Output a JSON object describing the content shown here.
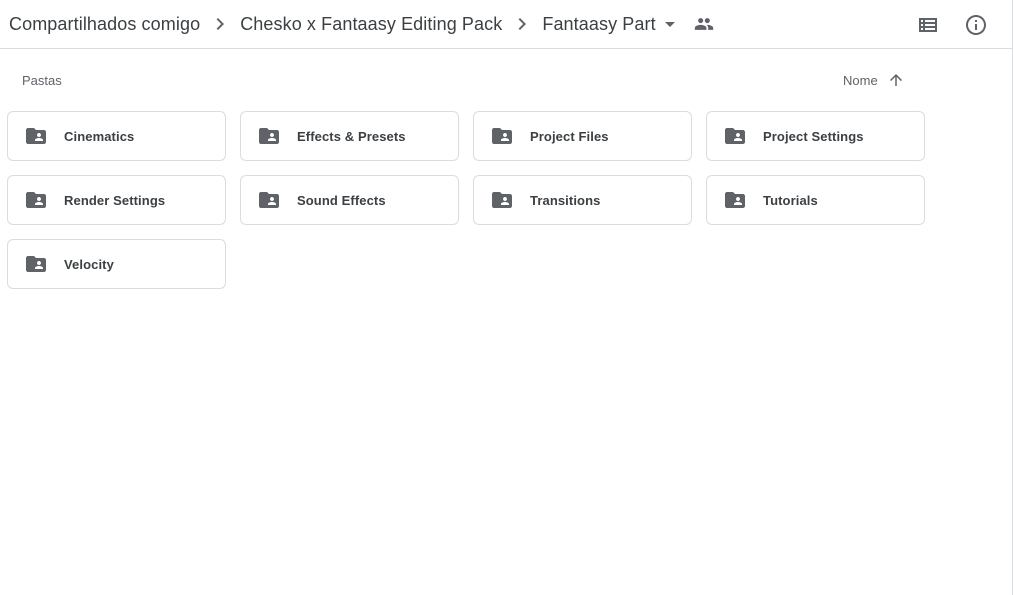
{
  "breadcrumb": {
    "items": [
      {
        "label": "Compartilhados comigo"
      },
      {
        "label": "Chesko x Fantaasy Editing Pack"
      },
      {
        "label": "Fantaasy Part"
      }
    ]
  },
  "header": {
    "icons": {
      "separator": "chevron-right-icon",
      "dropdown": "arrow-drop-down-icon",
      "shared": "people-icon",
      "list_view": "list-view-icon",
      "info": "info-icon"
    }
  },
  "section": {
    "label": "Pastas",
    "sort_label": "Nome",
    "sort_direction_icon": "arrow-up-icon"
  },
  "folders": [
    {
      "name": "Cinematics"
    },
    {
      "name": "Effects & Presets"
    },
    {
      "name": "Project Files"
    },
    {
      "name": "Project Settings"
    },
    {
      "name": "Render Settings"
    },
    {
      "name": "Sound Effects"
    },
    {
      "name": "Transitions"
    },
    {
      "name": "Tutorials"
    },
    {
      "name": "Velocity"
    }
  ],
  "colors": {
    "text": "#3c4043",
    "icon": "#5f6368",
    "border": "#dadce0"
  }
}
